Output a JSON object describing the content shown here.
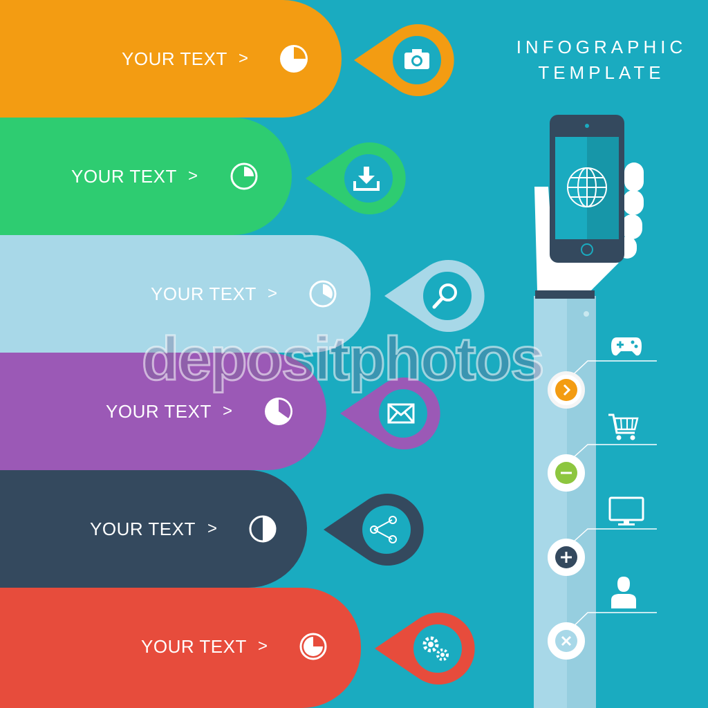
{
  "title": {
    "line1": "INFOGRAPHIC",
    "line2": "TEMPLATE"
  },
  "colors": {
    "background": "#1aabc0",
    "band_orange": "#f39c12",
    "band_green": "#2ecc71",
    "band_lightblue": "#a8d8e8",
    "band_purple": "#9b59b6",
    "band_navy": "#34495e",
    "band_red": "#e74c3c"
  },
  "bands": [
    {
      "label": "YOUR TEXT",
      "chevron": ">",
      "pie_fraction": 0.25,
      "icon": "camera-icon"
    },
    {
      "label": "YOUR TEXT",
      "chevron": ">",
      "pie_fraction": 0.25,
      "icon": "download-icon"
    },
    {
      "label": "YOUR TEXT",
      "chevron": ">",
      "pie_fraction": 0.33,
      "icon": "magnifier-icon"
    },
    {
      "label": "YOUR TEXT",
      "chevron": ">",
      "pie_fraction": 0.33,
      "icon": "envelope-icon"
    },
    {
      "label": "YOUR TEXT",
      "chevron": ">",
      "pie_fraction": 0.5,
      "icon": "share-icon"
    },
    {
      "label": "YOUR TEXT",
      "chevron": ">",
      "pie_fraction": 0.25,
      "icon": "gears-icon"
    }
  ],
  "right_items": [
    {
      "icon": "gamepad-icon",
      "node_icon": "arrow-right-icon",
      "node_color": "#f39c12"
    },
    {
      "icon": "shopping-cart-icon",
      "node_icon": "minus-icon",
      "node_color": "#8dc63f"
    },
    {
      "icon": "monitor-icon",
      "node_icon": "plus-icon",
      "node_color": "#34495e"
    },
    {
      "icon": "user-icon",
      "node_icon": "close-icon",
      "node_color": "#a8d8e8"
    }
  ],
  "phone": {
    "screen_icon": "globe-icon"
  },
  "watermark": "depositphotos"
}
